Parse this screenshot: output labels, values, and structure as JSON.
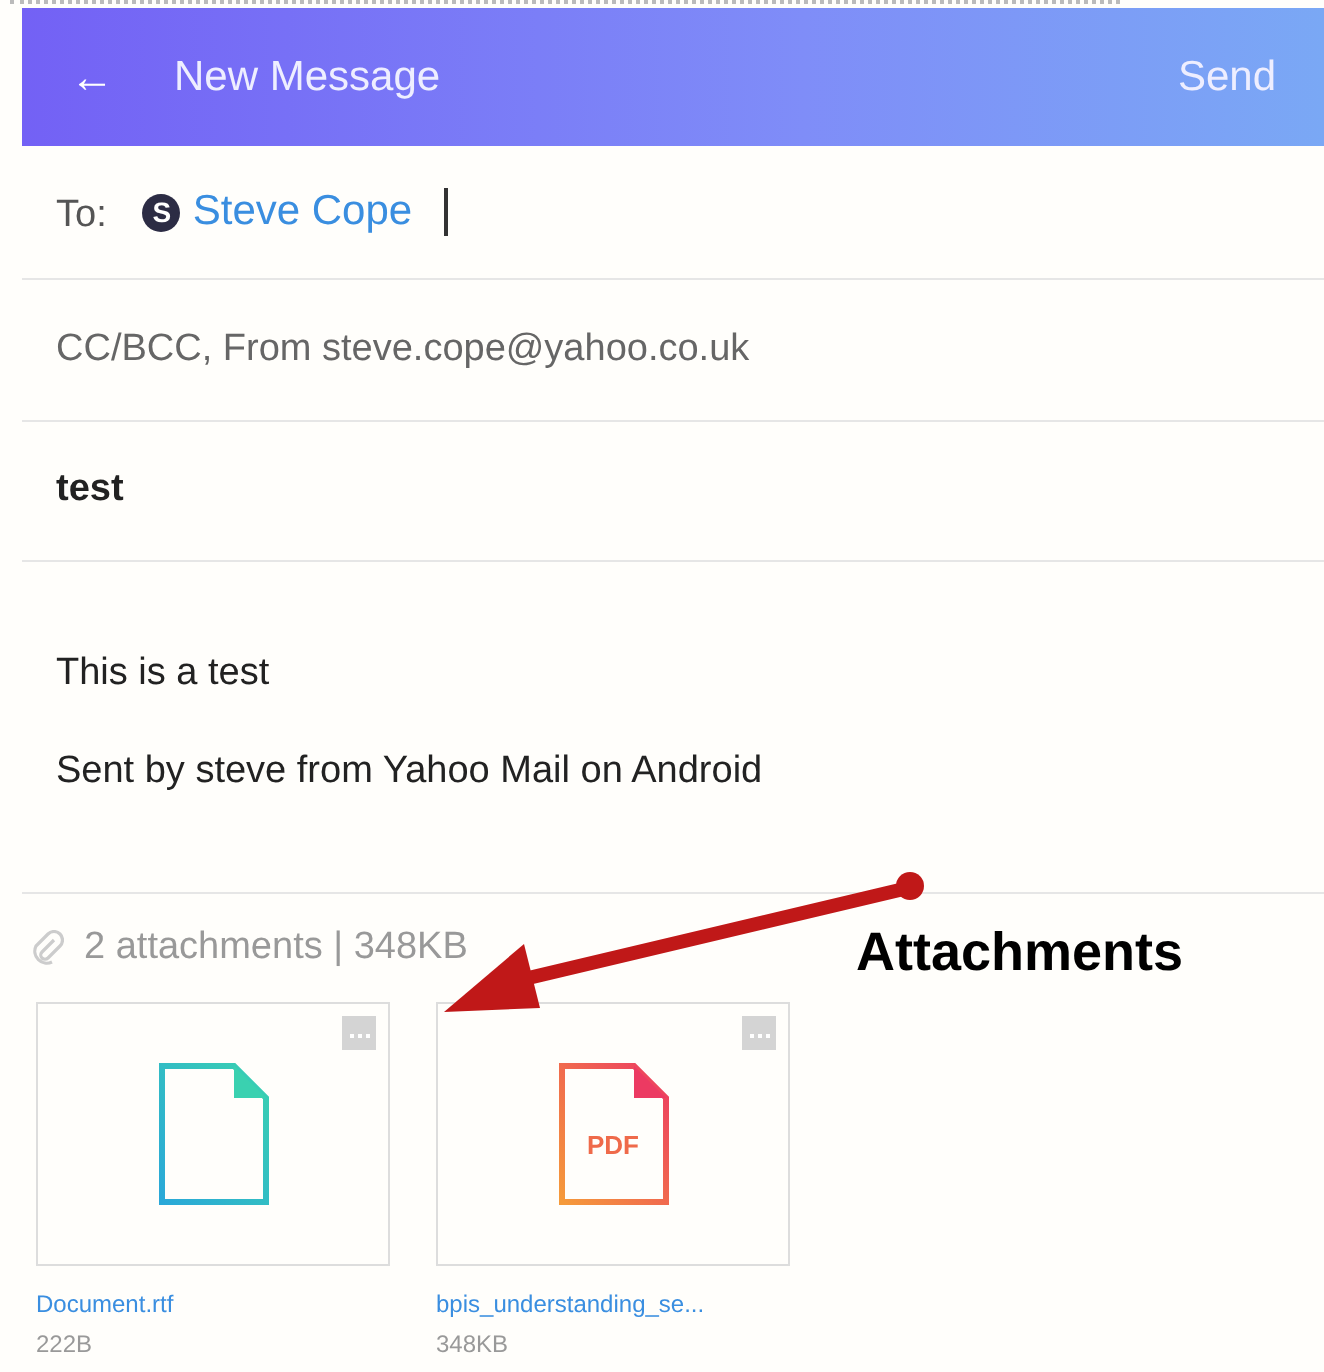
{
  "header": {
    "back": "←",
    "title": "New Message",
    "send": "Send"
  },
  "to": {
    "label": "To:",
    "recipient_initial": "S",
    "recipient": "Steve Cope"
  },
  "cc_from": "CC/BCC, From steve.cope@yahoo.co.uk",
  "subject": "test",
  "body": [
    "This is a test",
    "Sent by steve from Yahoo Mail on Android"
  ],
  "attachments": {
    "summary": "2 attachments | 348KB",
    "items": [
      {
        "kind": "document",
        "name": "Document.rtf",
        "size": "222B"
      },
      {
        "kind": "pdf",
        "badge": "PDF",
        "name": "bpis_understanding_se...",
        "size": "348KB"
      }
    ]
  },
  "annotation": {
    "label": "Attachments"
  }
}
